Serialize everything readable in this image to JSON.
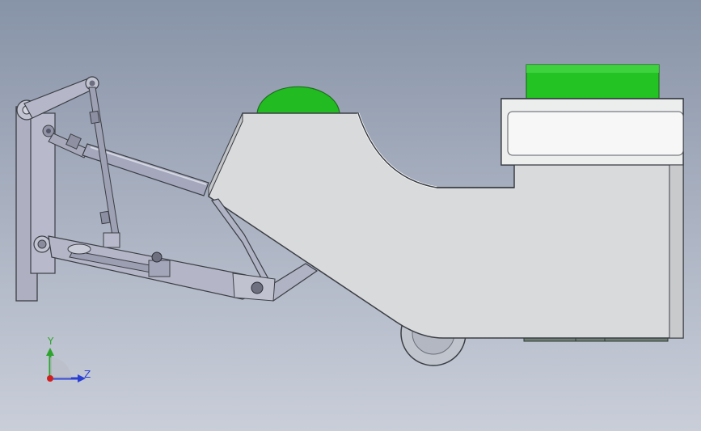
{
  "triad": {
    "y_label": "Y",
    "z_label": "Z",
    "y_color": "#2ea32e",
    "z_color": "#2b3fd1",
    "origin_color": "#d11f1f"
  },
  "colors": {
    "background_top": "#8793a7",
    "background_bottom": "#c9ced9",
    "body_fill": "#d9dadc",
    "body_outline": "#3b3e44",
    "accent_green": "#22bb22",
    "frame_fill": "#a9abbe",
    "wheel_fill": "#b8bcc6"
  }
}
